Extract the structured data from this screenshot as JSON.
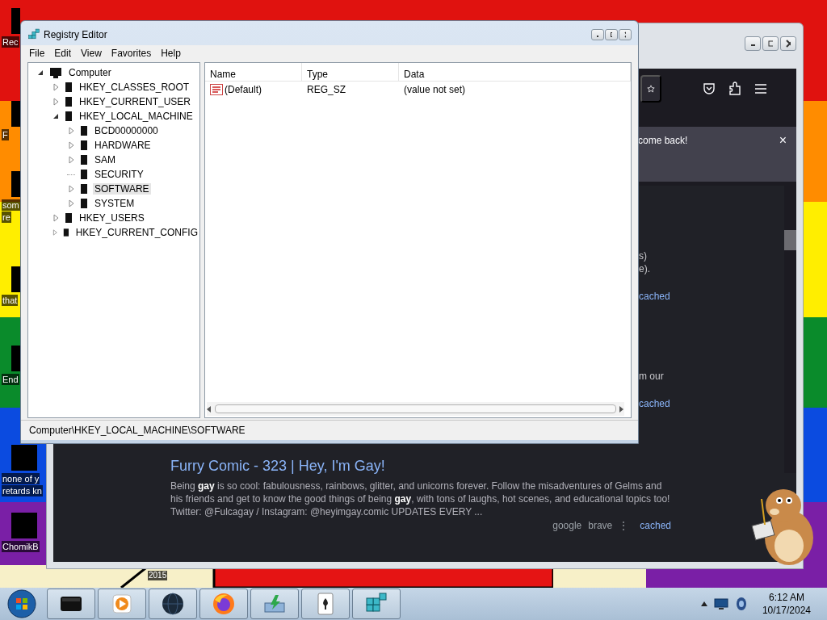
{
  "desktop": {
    "icons": [
      {
        "lines": [
          "Rec"
        ]
      },
      {
        "lines": [
          "F"
        ]
      },
      {
        "lines": [
          "som",
          "re"
        ]
      },
      {
        "lines": [
          "that"
        ]
      },
      {
        "lines": [
          "End"
        ]
      },
      {
        "lines": [
          "none of y",
          "retards kn"
        ]
      },
      {
        "lines": [
          "ChomikB"
        ]
      }
    ],
    "wallpaper_text": "2015"
  },
  "browser": {
    "notification": {
      "text": "come back!",
      "close": "×"
    },
    "fragments": [
      {
        "lines": [
          {
            "kind": "text",
            "text": "s)"
          },
          {
            "kind": "text",
            "text": "e)."
          }
        ]
      },
      {
        "lines": [
          {
            "kind": "link",
            "text": "cached"
          }
        ]
      },
      {
        "lines": [
          {
            "kind": "text",
            "text": "m our"
          }
        ]
      },
      {
        "lines": [
          {
            "kind": "link",
            "text": "cached"
          }
        ]
      }
    ],
    "result": {
      "title": "Furry Comic - 323 | Hey, I'm Gay!",
      "snippet": "Being **gay** is so cool: fabulousness, rainbows, glitter, and unicorns forever. Follow the misadventures of Gelms and his friends and get to know the good things of being **gay**, with tons of laughs, hot scenes, and educational topics too! Twitter: @Fulcagay / Instagram: @heyimgay.comic UPDATES EVERY ...",
      "sources": [
        "google",
        "brave"
      ],
      "more": "⋮",
      "cached": "cached"
    }
  },
  "registry": {
    "title": "Registry Editor",
    "menu": [
      "File",
      "Edit",
      "View",
      "Favorites",
      "Help"
    ],
    "tree": [
      {
        "label": "Computer",
        "expandable": true,
        "expanded": true,
        "selected": false,
        "children": [
          {
            "label": "HKEY_CLASSES_ROOT",
            "expandable": true,
            "expanded": false,
            "selected": false
          },
          {
            "label": "HKEY_CURRENT_USER",
            "expandable": true,
            "expanded": false,
            "selected": false
          },
          {
            "label": "HKEY_LOCAL_MACHINE",
            "expandable": true,
            "expanded": true,
            "selected": false,
            "children": [
              {
                "label": "BCD00000000",
                "expandable": true,
                "expanded": false,
                "selected": false
              },
              {
                "label": "HARDWARE",
                "expandable": true,
                "expanded": false,
                "selected": false
              },
              {
                "label": "SAM",
                "expandable": true,
                "expanded": false,
                "selected": false
              },
              {
                "label": "SECURITY",
                "expandable": false,
                "expanded": false,
                "selected": false
              },
              {
                "label": "SOFTWARE",
                "expandable": true,
                "expanded": false,
                "selected": true
              },
              {
                "label": "SYSTEM",
                "expandable": true,
                "expanded": false,
                "selected": false
              }
            ]
          },
          {
            "label": "HKEY_USERS",
            "expandable": true,
            "expanded": false,
            "selected": false
          },
          {
            "label": "HKEY_CURRENT_CONFIG",
            "expandable": true,
            "expanded": false,
            "selected": false
          }
        ]
      }
    ],
    "columns": [
      "Name",
      "Type",
      "Data"
    ],
    "rows": [
      {
        "name": "(Default)",
        "type": "REG_SZ",
        "data": "(value not set)"
      }
    ],
    "status_bar": "Computer\\HKEY_LOCAL_MACHINE\\SOFTWARE"
  },
  "taskbar": {
    "apps": [
      {
        "kind": "terminal"
      },
      {
        "kind": "media"
      },
      {
        "kind": "globe"
      },
      {
        "kind": "firefox"
      },
      {
        "kind": "download"
      },
      {
        "kind": "cards"
      },
      {
        "kind": "registry"
      }
    ],
    "time": "6:12 AM",
    "date": "10/17/2024"
  }
}
